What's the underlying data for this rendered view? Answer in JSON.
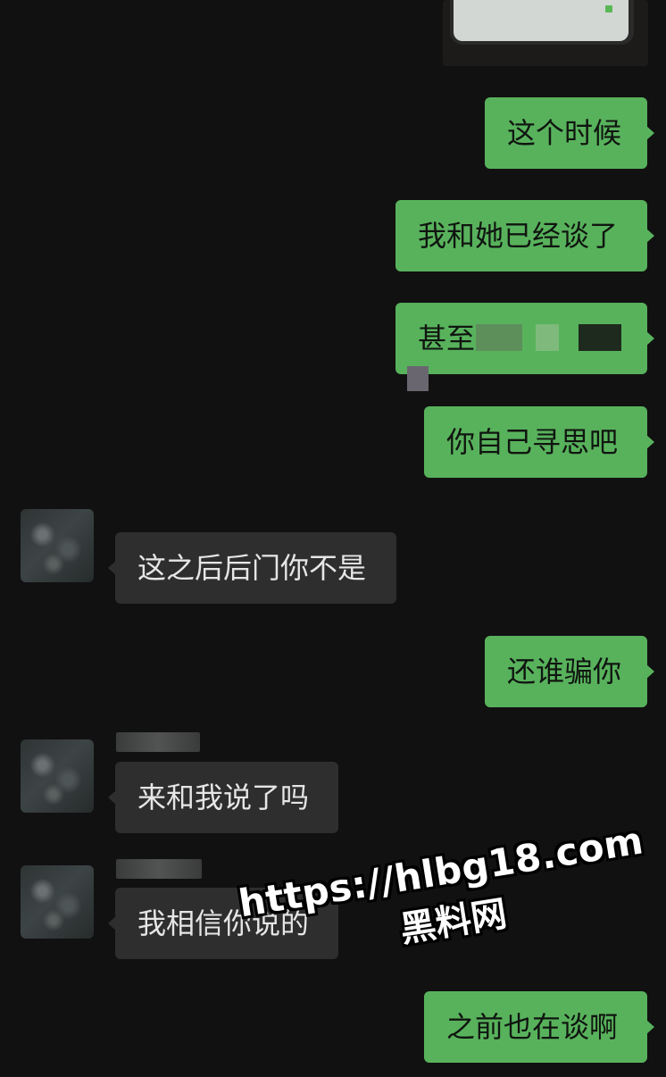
{
  "chat": {
    "messages": [
      {
        "id": "m1",
        "sender": "me",
        "text": "这个时候"
      },
      {
        "id": "m2",
        "sender": "me",
        "text": "我和她已经谈了"
      },
      {
        "id": "m3",
        "sender": "me",
        "text": "甚至"
      },
      {
        "id": "m4",
        "sender": "me",
        "text": "你自己寻思吧"
      },
      {
        "id": "m5",
        "sender": "other",
        "text": "这之后后门你不是"
      },
      {
        "id": "m6",
        "sender": "me",
        "text": "还谁骗你"
      },
      {
        "id": "m7",
        "sender": "other",
        "text": "来和我说了吗"
      },
      {
        "id": "m8",
        "sender": "other",
        "text": "我相信你说的"
      },
      {
        "id": "m9",
        "sender": "me",
        "text": "之前也在谈啊"
      }
    ]
  },
  "watermark": {
    "url": "https://hlbg18.com",
    "site": "黑料网"
  },
  "colors": {
    "background": "#111111",
    "sent_bubble": "#58b25c",
    "received_bubble": "#2e2e2e",
    "received_text": "#e6e6e6"
  }
}
